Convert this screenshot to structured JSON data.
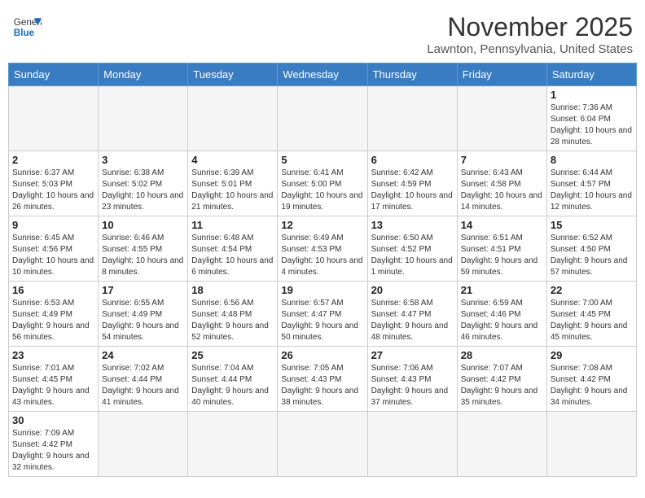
{
  "header": {
    "logo_general": "General",
    "logo_blue": "Blue",
    "month": "November 2025",
    "location": "Lawnton, Pennsylvania, United States"
  },
  "weekdays": [
    "Sunday",
    "Monday",
    "Tuesday",
    "Wednesday",
    "Thursday",
    "Friday",
    "Saturday"
  ],
  "weeks": [
    [
      {
        "day": "",
        "info": ""
      },
      {
        "day": "",
        "info": ""
      },
      {
        "day": "",
        "info": ""
      },
      {
        "day": "",
        "info": ""
      },
      {
        "day": "",
        "info": ""
      },
      {
        "day": "",
        "info": ""
      },
      {
        "day": "1",
        "info": "Sunrise: 7:36 AM\nSunset: 6:04 PM\nDaylight: 10 hours and 28 minutes."
      }
    ],
    [
      {
        "day": "2",
        "info": "Sunrise: 6:37 AM\nSunset: 5:03 PM\nDaylight: 10 hours and 26 minutes."
      },
      {
        "day": "3",
        "info": "Sunrise: 6:38 AM\nSunset: 5:02 PM\nDaylight: 10 hours and 23 minutes."
      },
      {
        "day": "4",
        "info": "Sunrise: 6:39 AM\nSunset: 5:01 PM\nDaylight: 10 hours and 21 minutes."
      },
      {
        "day": "5",
        "info": "Sunrise: 6:41 AM\nSunset: 5:00 PM\nDaylight: 10 hours and 19 minutes."
      },
      {
        "day": "6",
        "info": "Sunrise: 6:42 AM\nSunset: 4:59 PM\nDaylight: 10 hours and 17 minutes."
      },
      {
        "day": "7",
        "info": "Sunrise: 6:43 AM\nSunset: 4:58 PM\nDaylight: 10 hours and 14 minutes."
      },
      {
        "day": "8",
        "info": "Sunrise: 6:44 AM\nSunset: 4:57 PM\nDaylight: 10 hours and 12 minutes."
      }
    ],
    [
      {
        "day": "9",
        "info": "Sunrise: 6:45 AM\nSunset: 4:56 PM\nDaylight: 10 hours and 10 minutes."
      },
      {
        "day": "10",
        "info": "Sunrise: 6:46 AM\nSunset: 4:55 PM\nDaylight: 10 hours and 8 minutes."
      },
      {
        "day": "11",
        "info": "Sunrise: 6:48 AM\nSunset: 4:54 PM\nDaylight: 10 hours and 6 minutes."
      },
      {
        "day": "12",
        "info": "Sunrise: 6:49 AM\nSunset: 4:53 PM\nDaylight: 10 hours and 4 minutes."
      },
      {
        "day": "13",
        "info": "Sunrise: 6:50 AM\nSunset: 4:52 PM\nDaylight: 10 hours and 1 minute."
      },
      {
        "day": "14",
        "info": "Sunrise: 6:51 AM\nSunset: 4:51 PM\nDaylight: 9 hours and 59 minutes."
      },
      {
        "day": "15",
        "info": "Sunrise: 6:52 AM\nSunset: 4:50 PM\nDaylight: 9 hours and 57 minutes."
      }
    ],
    [
      {
        "day": "16",
        "info": "Sunrise: 6:53 AM\nSunset: 4:49 PM\nDaylight: 9 hours and 56 minutes."
      },
      {
        "day": "17",
        "info": "Sunrise: 6:55 AM\nSunset: 4:49 PM\nDaylight: 9 hours and 54 minutes."
      },
      {
        "day": "18",
        "info": "Sunrise: 6:56 AM\nSunset: 4:48 PM\nDaylight: 9 hours and 52 minutes."
      },
      {
        "day": "19",
        "info": "Sunrise: 6:57 AM\nSunset: 4:47 PM\nDaylight: 9 hours and 50 minutes."
      },
      {
        "day": "20",
        "info": "Sunrise: 6:58 AM\nSunset: 4:47 PM\nDaylight: 9 hours and 48 minutes."
      },
      {
        "day": "21",
        "info": "Sunrise: 6:59 AM\nSunset: 4:46 PM\nDaylight: 9 hours and 46 minutes."
      },
      {
        "day": "22",
        "info": "Sunrise: 7:00 AM\nSunset: 4:45 PM\nDaylight: 9 hours and 45 minutes."
      }
    ],
    [
      {
        "day": "23",
        "info": "Sunrise: 7:01 AM\nSunset: 4:45 PM\nDaylight: 9 hours and 43 minutes."
      },
      {
        "day": "24",
        "info": "Sunrise: 7:02 AM\nSunset: 4:44 PM\nDaylight: 9 hours and 41 minutes."
      },
      {
        "day": "25",
        "info": "Sunrise: 7:04 AM\nSunset: 4:44 PM\nDaylight: 9 hours and 40 minutes."
      },
      {
        "day": "26",
        "info": "Sunrise: 7:05 AM\nSunset: 4:43 PM\nDaylight: 9 hours and 38 minutes."
      },
      {
        "day": "27",
        "info": "Sunrise: 7:06 AM\nSunset: 4:43 PM\nDaylight: 9 hours and 37 minutes."
      },
      {
        "day": "28",
        "info": "Sunrise: 7:07 AM\nSunset: 4:42 PM\nDaylight: 9 hours and 35 minutes."
      },
      {
        "day": "29",
        "info": "Sunrise: 7:08 AM\nSunset: 4:42 PM\nDaylight: 9 hours and 34 minutes."
      }
    ],
    [
      {
        "day": "30",
        "info": "Sunrise: 7:09 AM\nSunset: 4:42 PM\nDaylight: 9 hours and 32 minutes."
      },
      {
        "day": "",
        "info": ""
      },
      {
        "day": "",
        "info": ""
      },
      {
        "day": "",
        "info": ""
      },
      {
        "day": "",
        "info": ""
      },
      {
        "day": "",
        "info": ""
      },
      {
        "day": "",
        "info": ""
      }
    ]
  ]
}
